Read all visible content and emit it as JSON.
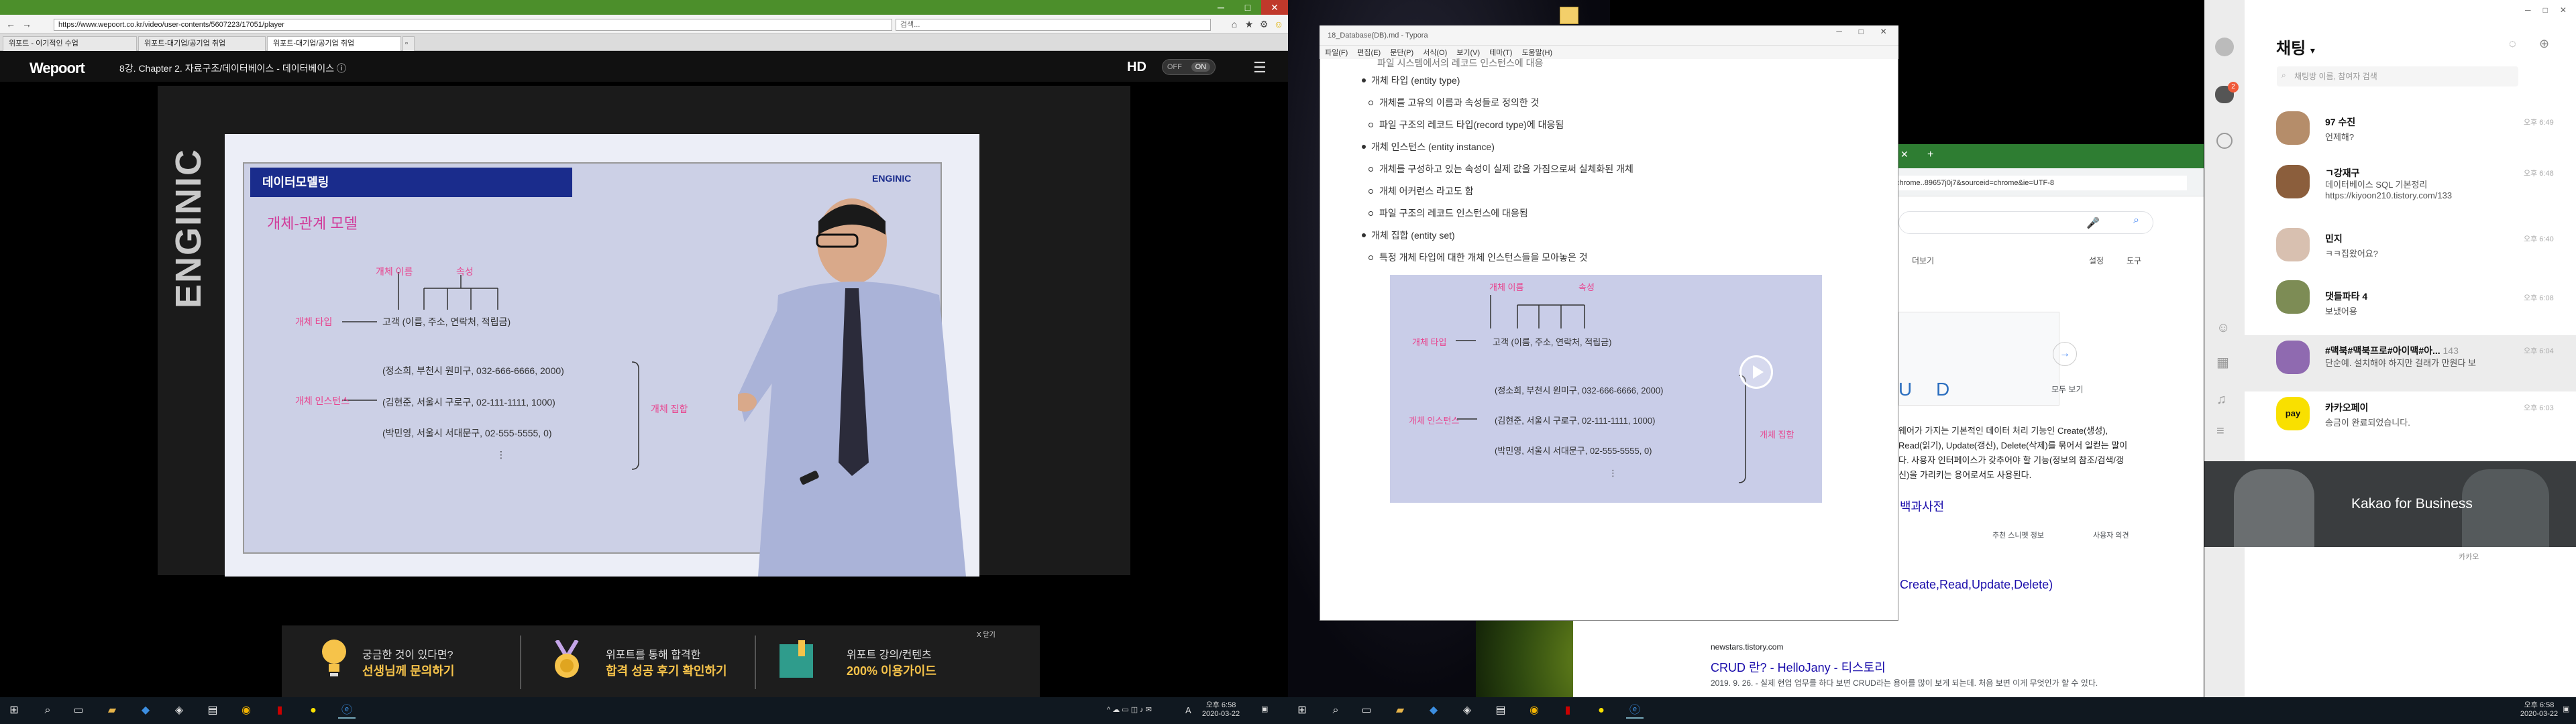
{
  "left_monitor": {
    "browser": {
      "url": "https://www.wepoort.co.kr/video/user-contents/5607223/17051/player",
      "search_placeholder": "검색...",
      "tabs": [
        {
          "label": "위포트 - 이기적인 수업"
        },
        {
          "label": "위포트-대기업/공기업 취업"
        },
        {
          "label": "위포트-대기업/공기업 취업"
        }
      ],
      "window_controls": {
        "minimize": "─",
        "maximize": "□",
        "close": "✕"
      },
      "nav": {
        "back": "←",
        "forward": "→",
        "home": "⌂",
        "favorite": "★",
        "settings": "⚙"
      }
    },
    "player": {
      "logo": "Wepoort",
      "lecture_title": "8강. Chapter 2. 자료구조/데이터베이스 - 데이터베이스",
      "info_icon": "ⓘ",
      "hd_label": "HD",
      "toggle_off": "OFF",
      "toggle_on": "ON",
      "menu_icon": "☰"
    },
    "slide": {
      "brand_vertical": "ENGINIC",
      "brand_corner": "ENGINIC",
      "header": "데이터모델링",
      "subtitle": "개체-관계 모델",
      "label_name": "개체 이름",
      "label_attr": "속성",
      "entity_type_label": "개체 타입",
      "entity_type_value": "고객 (이름, 주소, 연락처, 적립금)",
      "instance_label": "개체 인스턴스",
      "instances": [
        "(정소희, 부천시 원미구, 032-666-6666, 2000)",
        "(김현준, 서울시 구로구, 02-111-1111, 1000)",
        "(박민영, 서울시 서대문구, 02-555-5555, 0)"
      ],
      "ellipsis": "⋮",
      "set_label": "개체 집합"
    },
    "ads": [
      {
        "line1": "궁금한 것이 있다면?",
        "line2": "선생님께 문의하기",
        "icon": "lightbulb-icon"
      },
      {
        "line1": "위포트를 통해 합격한",
        "line2": "합격 성공 후기 확인하기",
        "icon": "medal-icon"
      },
      {
        "line1": "위포트 강의/컨텐츠",
        "line2": "200% 이용가이드",
        "icon": "book-icon"
      }
    ],
    "ad_close": "X 닫기",
    "taskbar": {
      "time": "오후 6:58",
      "date": "2020-03-22",
      "ime": "A"
    }
  },
  "right_monitor": {
    "typora": {
      "title": "18_Database(DB).md - Typora",
      "menu": [
        "파일(F)",
        "편집(E)",
        "문단(P)",
        "서식(O)",
        "보기(V)",
        "테마(T)",
        "도움말(H)"
      ],
      "top_cut": "파일 시스템에서의 레코드 인스턴스에 대응",
      "outline": [
        {
          "text": "개체 타입 (entity type)",
          "children": [
            "개체를 고유의 이름과 속성들로 정의한 것",
            "파일 구조의 레코드 타입(record type)에 대응됨"
          ]
        },
        {
          "text": "개체 인스턴스 (entity instance)",
          "children": [
            "개체를 구성하고 있는 속성이 실제 값을 가짐으로써 실체화된 개체",
            "개체 어커런스 라고도 함",
            "파일 구조의 레코드 인스턴스에 대응됨"
          ]
        },
        {
          "text": "개체 집합 (entity set)",
          "children": [
            "특정 개체 타입에 대한 개체 인스턴스들을 모아놓은 것"
          ]
        }
      ]
    },
    "chrome": {
      "address": "chrome..89657j0j7&sourceid=chrome&ie=UTF-8",
      "results": [
        {
          "snippet": "웨어가 가지는 기본적인 데이터 처리 기능인 Create(생성), Read(읽기), Update(갱신), Delete(삭제)를 묶어서 일컫는 말이다. 사용자 인터페이스가 갖추어야 할 기능(정보의 참조/검색/갱신)을 가리키는 용어로서도 사용된다."
        },
        {
          "link": "백과사전"
        },
        {
          "link": "Create,Read,Update,Delete)"
        },
        {
          "url": "newstars.tistory.com",
          "link": "CRUD 란? - HelloJany - 티스토리",
          "snippet": "2019. 9. 26. - 실제 현업 업무를 하다 보면 CRUD라는 용어를 많이 보게 되는데. 처음 보면 이게 무엇인가 할 수 있다."
        }
      ],
      "tools": [
        "설정",
        "도구"
      ],
      "more": "더보기",
      "view_all": "모두 보기",
      "feedback": [
        "추천 스니펫 정보",
        "사용자 의견"
      ],
      "crud": "U  D"
    },
    "kakao": {
      "title": "채팅",
      "search_placeholder": "채팅방 이름, 참여자 검색",
      "badge": "2",
      "chats": [
        {
          "name": "97 수진",
          "msg": "언제해?",
          "time": "오후 6:49"
        },
        {
          "name": "ㄱ강재구",
          "msg": "데이터베이스 SQL 기본정리 https://kiyoon210.tistory.com/133",
          "time": "오후 6:48"
        },
        {
          "name": "민지",
          "msg": "ㅋㅋ집왔어요?",
          "time": "오후 6:40"
        },
        {
          "name": "댓들파타 4",
          "msg": "보냈어용",
          "time": "오후 6:08"
        },
        {
          "name": "#맥북#맥북프로#아이맥#아...",
          "count": "143",
          "msg": "단순예. 설치해야 하지만 걸래가 만원다 보",
          "time": "오후 6:04"
        },
        {
          "name": "카카오페이",
          "msg": "송금이 완료되었습니다.",
          "time": "오후 6:03"
        }
      ],
      "ad_text": "Kakao for Business",
      "ad_footer": "카카오"
    },
    "taskbar": {
      "time": "오후 6:58",
      "date": "2020-03-22"
    }
  }
}
